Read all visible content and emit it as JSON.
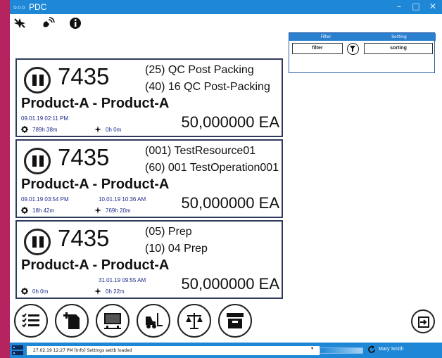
{
  "window": {
    "title": "PDC",
    "logo_text": "ooo",
    "minimize": "–",
    "maximize": "□",
    "close": "✕"
  },
  "toolbar": {
    "icons": [
      "airplane-icon",
      "satellite-icon",
      "info-icon"
    ]
  },
  "panel": {
    "filter_header": "Filter",
    "sorting_header": "Sorting",
    "filter_value": "filter",
    "sorting_value": "sorting"
  },
  "cards": [
    {
      "number": "7435",
      "op_line1": "(25) QC Post Packing",
      "op_line2": "(40) 16 QC Post-Packing",
      "product": "Product-A - Product-A",
      "date1": "09.01.19 02:11 PM",
      "date2": "",
      "time1": "789h 38m",
      "time2": "0h 0m",
      "quantity": "50,000000 EA"
    },
    {
      "number": "7435",
      "op_line1": "(001) TestResource01",
      "op_line2": "(60) 001 TestOperation001",
      "product": "Product-A - Product-A",
      "date1": "09.01.19 03:54 PM",
      "date2": "10.01.19 10:36 AM",
      "time1": "18h 42m",
      "time2": "769h 20m",
      "quantity": "50,000000 EA"
    },
    {
      "number": "7435",
      "op_line1": "(05) Prep",
      "op_line2": "(10) 04 Prep",
      "product": "Product-A - Product-A",
      "date1": "",
      "date2": "31.01.19 09:55 AM",
      "time1": "0h 0m",
      "time2": "0h 22m",
      "quantity": "50,000000 EA"
    }
  ],
  "bottom_buttons": [
    "checklist-icon",
    "add-document-icon",
    "monitor-icon",
    "forklift-icon",
    "scale-icon",
    "archive-icon"
  ],
  "status": {
    "message": "27.02.19 12:27 PM    [Info]  Settings settb loaded",
    "dropdown": "▾",
    "user": "Mary Smith"
  },
  "colors": {
    "accent": "#1e88d6",
    "card_border": "#2f3b5a",
    "date_text": "#1d2a8a",
    "background": "#b5245f"
  }
}
